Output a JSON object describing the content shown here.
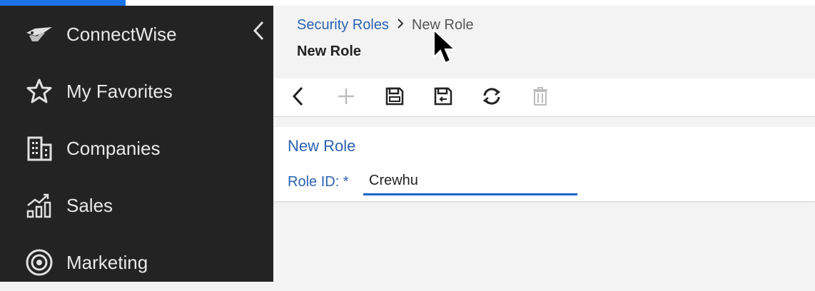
{
  "sidebar": {
    "items": [
      {
        "label": "ConnectWise",
        "icon": "connectwise-logo-icon"
      },
      {
        "label": "My Favorites",
        "icon": "star-icon"
      },
      {
        "label": "Companies",
        "icon": "building-icon"
      },
      {
        "label": "Sales",
        "icon": "sales-chart-icon"
      },
      {
        "label": "Marketing",
        "icon": "target-icon"
      }
    ],
    "collapse_icon": "chevron-left-icon"
  },
  "breadcrumb": {
    "parent": "Security Roles",
    "current": "New Role"
  },
  "page": {
    "title": "New Role"
  },
  "toolbar": {
    "buttons": [
      "back-icon",
      "add-icon",
      "save-icon",
      "save-and-close-icon",
      "refresh-icon",
      "delete-icon"
    ]
  },
  "form": {
    "title": "New Role",
    "role_id_label": "Role ID: *",
    "role_id_value": "Crewhu"
  },
  "colors": {
    "accent": "#1a73e8",
    "link": "#2a62b0",
    "sidebar_bg": "#232323"
  }
}
